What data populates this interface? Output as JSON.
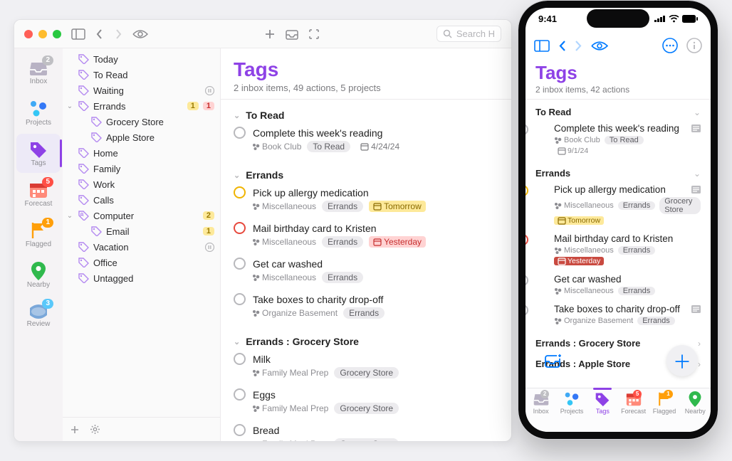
{
  "mac": {
    "search_placeholder": "Search H",
    "rail": [
      {
        "name": "inbox",
        "label": "Inbox",
        "badge": "2",
        "badgeClass": ""
      },
      {
        "name": "projects",
        "label": "Projects"
      },
      {
        "name": "tags",
        "label": "Tags",
        "active": true
      },
      {
        "name": "forecast",
        "label": "Forecast",
        "badge": "5",
        "badgeClass": "red"
      },
      {
        "name": "flagged",
        "label": "Flagged",
        "badge": "1",
        "badgeClass": "orange"
      },
      {
        "name": "nearby",
        "label": "Nearby"
      },
      {
        "name": "review",
        "label": "Review",
        "badge": "3",
        "badgeClass": "teal"
      }
    ],
    "tree": [
      {
        "indent": 0,
        "label": "Today"
      },
      {
        "indent": 0,
        "label": "To Read"
      },
      {
        "indent": 0,
        "label": "Waiting",
        "pause": true
      },
      {
        "indent": 0,
        "label": "Errands",
        "expanded": true,
        "counts": [
          {
            "n": "1",
            "c": "cnt-y"
          },
          {
            "n": "1",
            "c": "cnt-r"
          }
        ]
      },
      {
        "indent": 1,
        "label": "Grocery Store"
      },
      {
        "indent": 1,
        "label": "Apple Store"
      },
      {
        "indent": 0,
        "label": "Home"
      },
      {
        "indent": 0,
        "label": "Family"
      },
      {
        "indent": 0,
        "label": "Work"
      },
      {
        "indent": 0,
        "label": "Calls"
      },
      {
        "indent": 0,
        "label": "Computer",
        "expanded": true,
        "shared": true,
        "counts": [
          {
            "n": "2",
            "c": "cnt-y"
          }
        ]
      },
      {
        "indent": 1,
        "label": "Email",
        "counts": [
          {
            "n": "1",
            "c": "cnt-y"
          }
        ]
      },
      {
        "indent": 0,
        "label": "Vacation",
        "pause": true
      },
      {
        "indent": 0,
        "label": "Office"
      },
      {
        "indent": 0,
        "label": "Untagged"
      }
    ],
    "content": {
      "title": "Tags",
      "sub": "2 inbox items, 49 actions, 5 projects",
      "groups": [
        {
          "name": "To Read",
          "tasks": [
            {
              "title": "Complete this week's reading",
              "project": "Book Club",
              "tags": [
                "To Read"
              ],
              "date": {
                "txt": "4/24/24",
                "cls": "plain"
              }
            }
          ]
        },
        {
          "name": "Errands",
          "tasks": [
            {
              "title": "Pick up allergy medication",
              "project": "Miscellaneous",
              "tags": [
                "Errands"
              ],
              "date": {
                "txt": "Tomorrow",
                "cls": "tom"
              },
              "circ": "due"
            },
            {
              "title": "Mail birthday card to Kristen",
              "project": "Miscellaneous",
              "tags": [
                "Errands"
              ],
              "date": {
                "txt": "Yesterday",
                "cls": "yest"
              },
              "circ": "over"
            },
            {
              "title": "Get car washed",
              "project": "Miscellaneous",
              "tags": [
                "Errands"
              ]
            },
            {
              "title": "Take boxes to charity drop-off",
              "project": "Organize Basement",
              "tags": [
                "Errands"
              ]
            }
          ]
        },
        {
          "name": "Errands : Grocery Store",
          "tasks": [
            {
              "title": "Milk",
              "project": "Family Meal Prep",
              "tags": [
                "Grocery Store"
              ]
            },
            {
              "title": "Eggs",
              "project": "Family Meal Prep",
              "tags": [
                "Grocery Store"
              ]
            },
            {
              "title": "Bread",
              "project": "Family Meal Prep",
              "tags": [
                "Grocery Store"
              ]
            }
          ]
        }
      ]
    }
  },
  "iphone": {
    "time": "9:41",
    "hdr": {
      "title": "Tags",
      "sub": "2 inbox items, 42 actions"
    },
    "sections": [
      {
        "name": "To Read",
        "chev": "⌄",
        "tasks": [
          {
            "title": "Complete this week's reading",
            "project": "Book Club",
            "tags": [
              "To Read"
            ],
            "date": {
              "txt": "9/1/24",
              "cls": "plain"
            },
            "note": true
          }
        ]
      },
      {
        "name": "Errands",
        "chev": "⌄",
        "tasks": [
          {
            "title": "Pick up allergy medication",
            "project": "Miscellaneous",
            "tags": [
              "Errands",
              "Grocery Store"
            ],
            "date": {
              "txt": "Tomorrow",
              "cls": "tom"
            },
            "circ": "due",
            "note": true
          },
          {
            "title": "Mail birthday card to Kristen",
            "project": "Miscellaneous",
            "tags": [
              "Errands"
            ],
            "date": {
              "txt": "Yesterday",
              "cls": "yest"
            },
            "circ": "over"
          },
          {
            "title": "Get car washed",
            "project": "Miscellaneous",
            "tags": [
              "Errands"
            ]
          },
          {
            "title": "Take boxes to charity drop-off",
            "project": "Organize Basement",
            "tags": [
              "Errands"
            ],
            "note": true
          }
        ]
      },
      {
        "name": "Errands  :  Grocery Store",
        "chev": "›"
      },
      {
        "name": "Errands  :  Apple Store",
        "chev": "›"
      }
    ],
    "tabs": [
      {
        "name": "inbox",
        "label": "Inbox",
        "badge": "2",
        "bcl": "tb-gray"
      },
      {
        "name": "projects",
        "label": "Projects"
      },
      {
        "name": "tags",
        "label": "Tags",
        "active": true
      },
      {
        "name": "forecast",
        "label": "Forecast",
        "badge": "5",
        "bcl": "tb-red"
      },
      {
        "name": "flagged",
        "label": "Flagged",
        "badge": "1",
        "bcl": "tb-orange"
      },
      {
        "name": "nearby",
        "label": "Nearby"
      }
    ]
  }
}
